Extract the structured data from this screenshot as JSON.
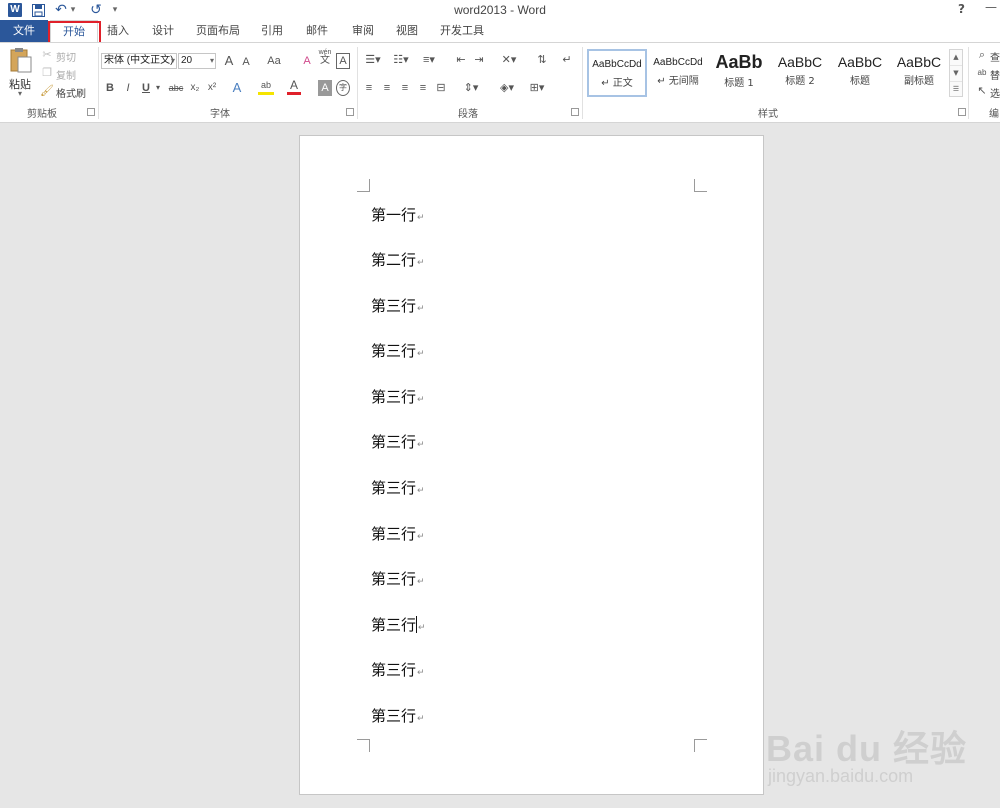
{
  "app": {
    "icon_letter": "W",
    "title": "word2013 - Word",
    "help": "?",
    "minimize": "—"
  },
  "quick_access": {
    "save": "💾",
    "undo": "↶",
    "undo_arrow": "▾",
    "redo": "↺",
    "customize": "▾"
  },
  "tabs": [
    {
      "label": "文件"
    },
    {
      "label": "开始"
    },
    {
      "label": "插入"
    },
    {
      "label": "设计"
    },
    {
      "label": "页面布局"
    },
    {
      "label": "引用"
    },
    {
      "label": "邮件"
    },
    {
      "label": "审阅"
    },
    {
      "label": "视图"
    },
    {
      "label": "开发工具"
    }
  ],
  "active_tab": "开始",
  "clipboard": {
    "group_label": "剪贴板",
    "paste": "粘贴",
    "cut": "剪切",
    "copy": "复制",
    "format_painter": "格式刷"
  },
  "font": {
    "group_label": "字体",
    "font_name": "宋体 (中文正文)",
    "font_size": "20",
    "grow": "A",
    "shrink": "A",
    "case": "Aa",
    "clear": "A",
    "phonetic": "wén",
    "phonetic_char": "文",
    "border_char": "A",
    "bold": "B",
    "italic": "I",
    "underline": "U",
    "strike": "abc",
    "subscript": "x₂",
    "superscript": "x²",
    "effects": "A",
    "highlight": "ab",
    "color": "A",
    "shading": "A",
    "enclose": "字"
  },
  "paragraph": {
    "group_label": "段落"
  },
  "styles": {
    "group_label": "样式",
    "items": [
      {
        "sample": "AaBbCcDd",
        "name": "↵ 正文"
      },
      {
        "sample": "AaBbCcDd",
        "name": "↵ 无间隔"
      },
      {
        "sample": "AaBb",
        "name": "标题 1"
      },
      {
        "sample": "AaBbC",
        "name": "标题 2"
      },
      {
        "sample": "AaBbC",
        "name": "标题"
      },
      {
        "sample": "AaBbC",
        "name": "副标题"
      }
    ]
  },
  "editing": {
    "group_label": "编",
    "find": "查",
    "replace": "替",
    "select": "选"
  },
  "document": {
    "lines": [
      "第一行",
      "第二行",
      "第三行",
      "第三行",
      "第三行",
      "第三行",
      "第三行",
      "第三行",
      "第三行",
      "第三行",
      "第三行",
      "第三行"
    ],
    "paragraph_mark": "↵",
    "caret_line": 10
  },
  "watermark": {
    "logo": "Bai du 经验",
    "site": "jingyan.baidu.com"
  }
}
